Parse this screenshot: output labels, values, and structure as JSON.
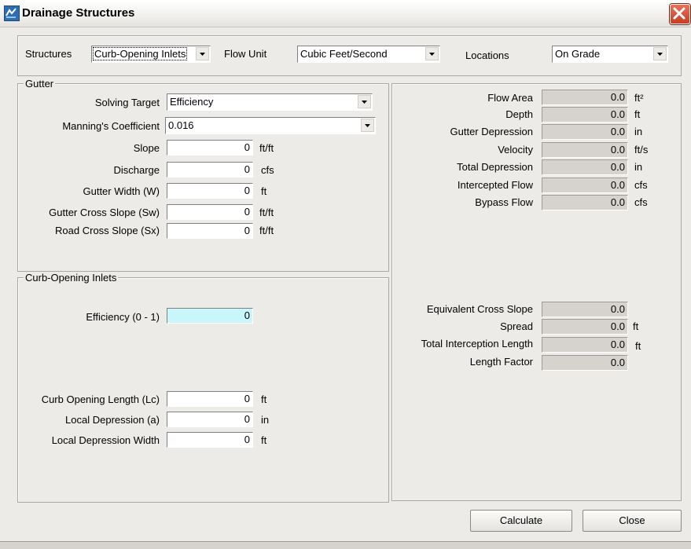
{
  "window": {
    "title": "Drainage Structures"
  },
  "top": {
    "structures_label": "Structures",
    "structures_value": "Curb-Opening Inlets",
    "flow_unit_label": "Flow Unit",
    "flow_unit_value": "Cubic Feet/Second",
    "locations_label": "Locations",
    "locations_value": "On Grade"
  },
  "gutter": {
    "legend": "Gutter",
    "solving_target_label": "Solving Target",
    "solving_target_value": "Efficiency",
    "mannings_label": "Manning's Coefficient",
    "mannings_value": "0.016",
    "fields": [
      {
        "label": "Slope",
        "value": "0",
        "unit": "ft/ft"
      },
      {
        "label": "Discharge",
        "value": "0",
        "unit": "cfs"
      },
      {
        "label": "Gutter Width (W)",
        "value": "0",
        "unit": "ft"
      },
      {
        "label": "Gutter Cross Slope (Sw)",
        "value": "0",
        "unit": "ft/ft"
      },
      {
        "label": "Road Cross Slope (Sx)",
        "value": "0",
        "unit": "ft/ft"
      }
    ]
  },
  "curb": {
    "legend": "Curb-Opening Inlets",
    "efficiency_label": "Efficiency (0 - 1)",
    "efficiency_value": "0",
    "fields": [
      {
        "label": "Curb Opening Length (Lc)",
        "value": "0",
        "unit": "ft"
      },
      {
        "label": "Local Depression (a)",
        "value": "0",
        "unit": "in"
      },
      {
        "label": "Local Depression Width",
        "value": "0",
        "unit": "ft"
      }
    ]
  },
  "results": {
    "top": [
      {
        "label": "Flow Area",
        "value": "0.0",
        "unit": "ft²"
      },
      {
        "label": "Depth",
        "value": "0.0",
        "unit": "ft"
      },
      {
        "label": "Gutter Depression",
        "value": "0.0",
        "unit": "in"
      },
      {
        "label": "Velocity",
        "value": "0.0",
        "unit": "ft/s"
      },
      {
        "label": "Total Depression",
        "value": "0.0",
        "unit": "in"
      },
      {
        "label": "Intercepted Flow",
        "value": "0.0",
        "unit": "cfs"
      },
      {
        "label": "Bypass Flow",
        "value": "0.0",
        "unit": "cfs"
      }
    ],
    "bottom": [
      {
        "label": "Equivalent Cross Slope",
        "value": "0.0",
        "unit": ""
      },
      {
        "label": "Spread",
        "value": "0.0",
        "unit": "ft"
      },
      {
        "label": "Total Interception Length",
        "value": "0.0",
        "unit": "ft"
      },
      {
        "label": "Length Factor",
        "value": "0.0",
        "unit": ""
      }
    ]
  },
  "buttons": {
    "calculate": "Calculate",
    "close": "Close"
  }
}
